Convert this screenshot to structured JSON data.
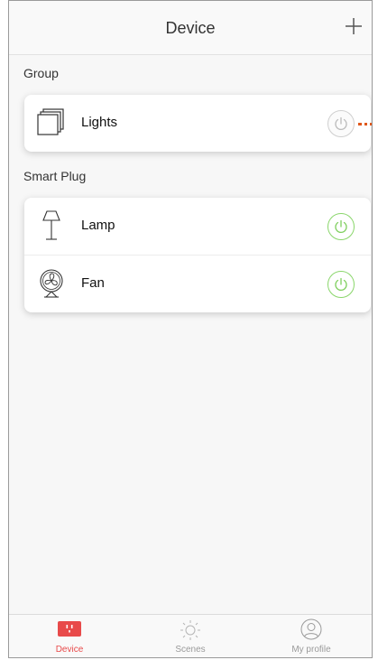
{
  "header": {
    "title": "Device",
    "add_icon": "plus-icon"
  },
  "groups_section": {
    "label": "Group",
    "items": [
      {
        "name": "Lights",
        "icon": "stack-squares-icon",
        "power": "off"
      }
    ]
  },
  "smart_plug_section": {
    "label": "Smart Plug",
    "items": [
      {
        "name": "Lamp",
        "icon": "floor-lamp-icon",
        "power": "on"
      },
      {
        "name": "Fan",
        "icon": "fan-icon",
        "power": "on"
      }
    ]
  },
  "tabs": [
    {
      "label": "Device",
      "icon": "plug-icon",
      "active": true
    },
    {
      "label": "Scenes",
      "icon": "sun-icon",
      "active": false
    },
    {
      "label": "My profile",
      "icon": "profile-icon",
      "active": false
    }
  ],
  "colors": {
    "accent": "#e84a4a",
    "power_on": "#8ad66b",
    "power_off": "#cfcfcf",
    "annotation": "#e0581c",
    "tab_inactive": "#9a9a9a"
  }
}
